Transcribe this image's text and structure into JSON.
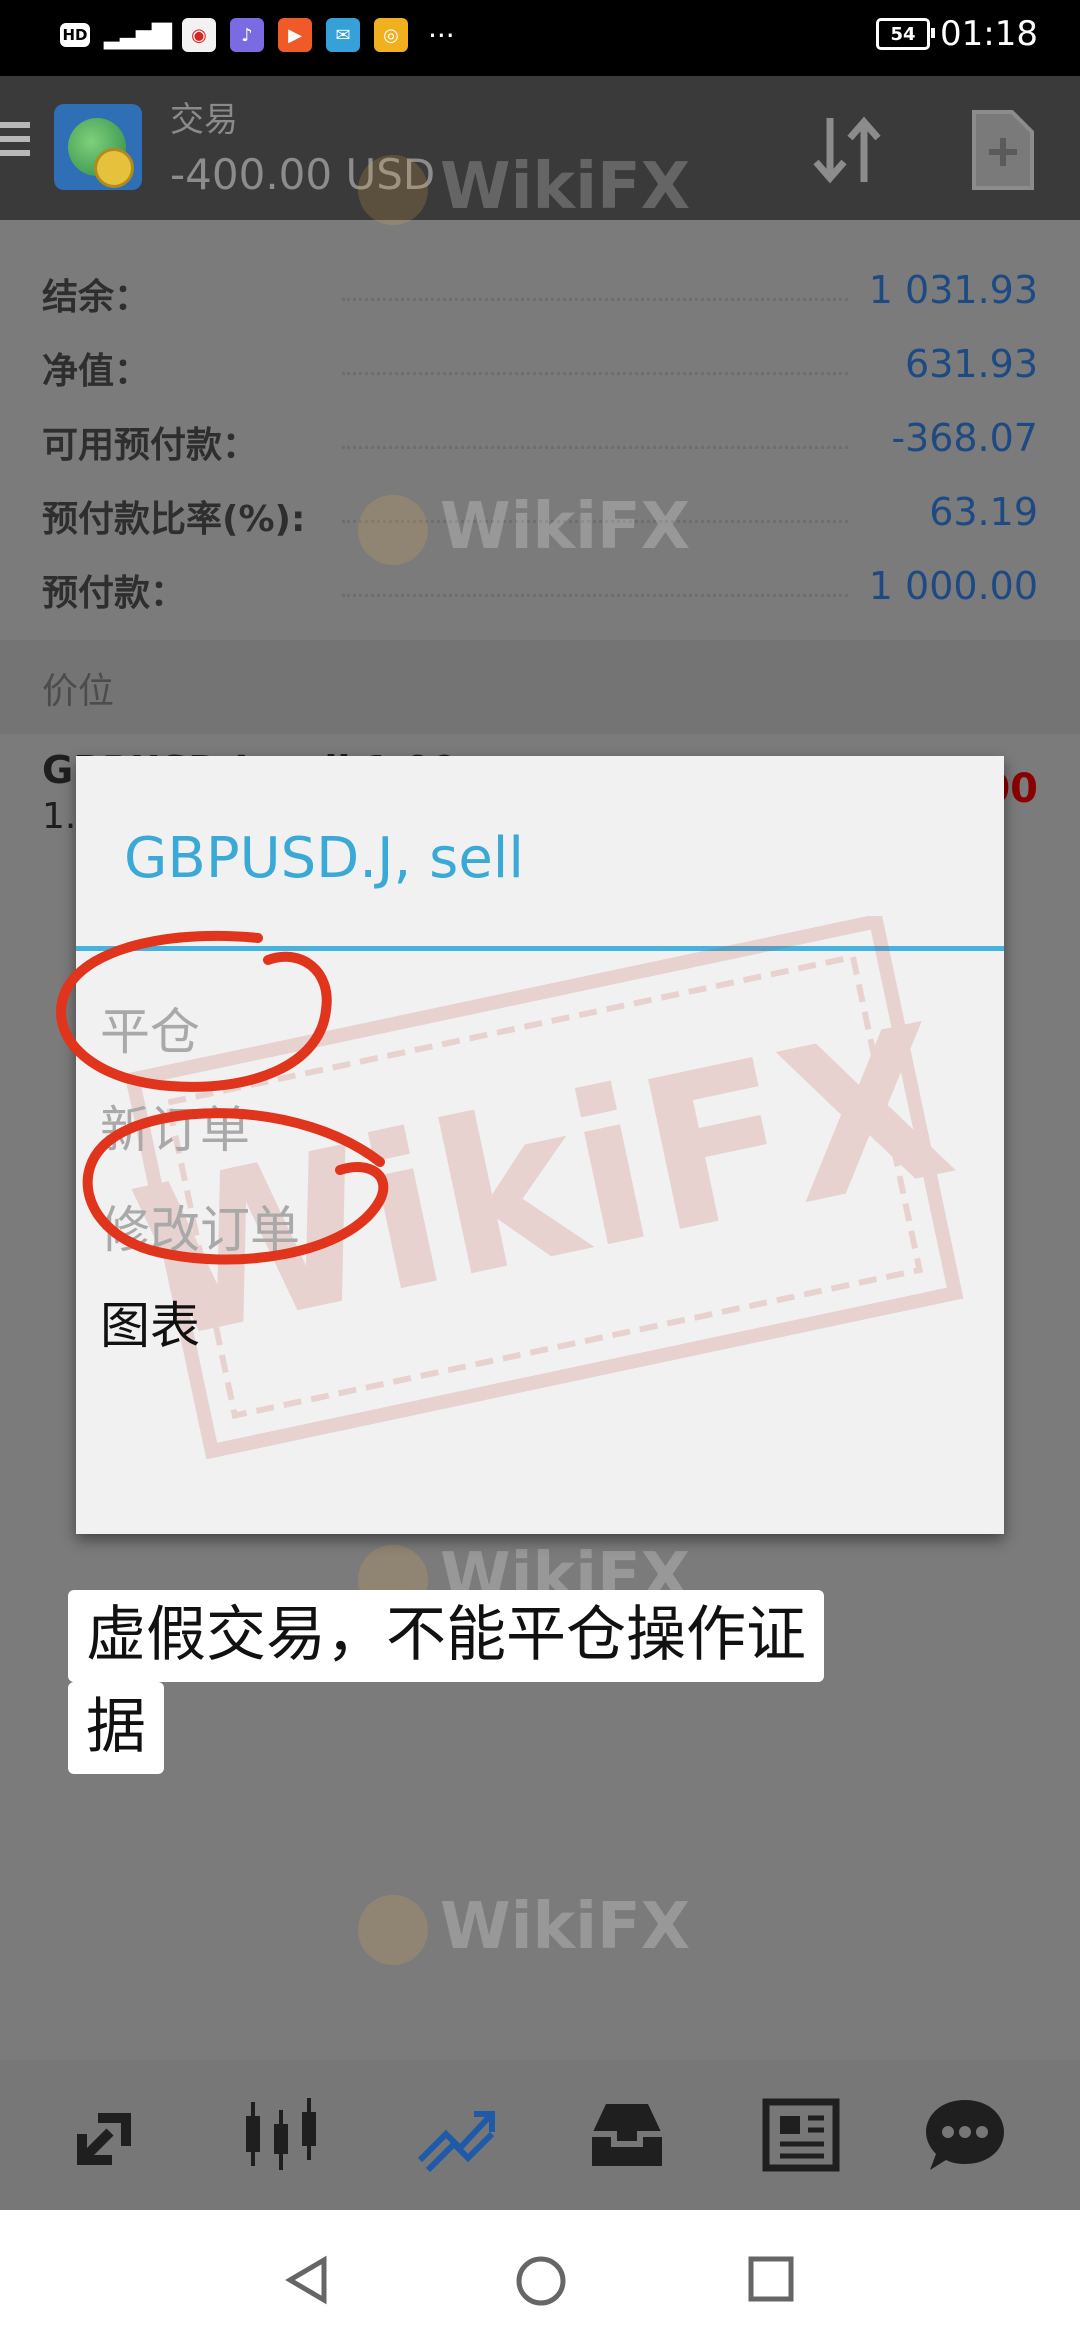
{
  "status_bar": {
    "hd": "HD",
    "signal": "46",
    "time": "01:18",
    "battery": "54",
    "more": "···"
  },
  "app_bar": {
    "title": "交易",
    "subtitle": "-400.00 USD"
  },
  "account": [
    {
      "label": "结余：",
      "value": "1 031.93"
    },
    {
      "label": "净值：",
      "value": "631.93"
    },
    {
      "label": "可用预付款：",
      "value": "-368.07"
    },
    {
      "label": "预付款比率(%):",
      "value": "63.19"
    },
    {
      "label": "预付款：",
      "value": "1 000.00"
    }
  ],
  "section_header": "价位",
  "position": {
    "symbol": "GBPUSD.J, sell 1.00",
    "volume": "1.3",
    "profit": "-400.00"
  },
  "dialog": {
    "title": "GBPUSD.J, sell",
    "items": [
      {
        "label": "平仓",
        "enabled": false
      },
      {
        "label": "新订单",
        "enabled": false
      },
      {
        "label": "修改订单",
        "enabled": false
      },
      {
        "label": "图表",
        "enabled": true
      }
    ]
  },
  "caption": {
    "line1": "虚假交易，不能平仓操作证",
    "line2": "据"
  },
  "watermark": {
    "text": "WikiFX",
    "stamp": "WikiFX"
  },
  "colors": {
    "accent": "#3aa9d6",
    "value_blue": "#1d4a83",
    "profit_red": "#8a0000",
    "annotation_red": "#e0341c"
  },
  "bottom_nav_icons": [
    "quotes-icon",
    "chart-icon",
    "trade-icon",
    "history-icon",
    "news-icon",
    "chat-icon"
  ]
}
